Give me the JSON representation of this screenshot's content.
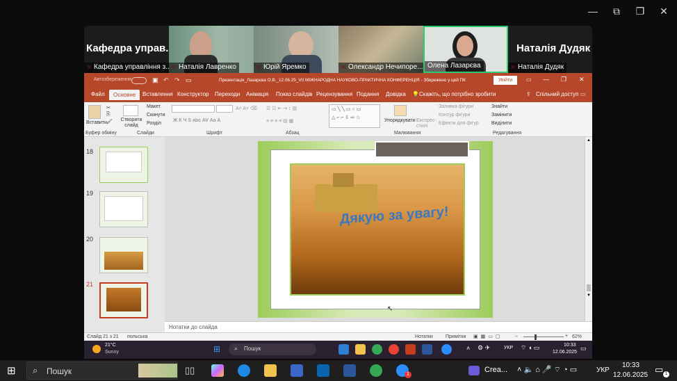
{
  "zoom": {
    "window_controls": [
      "—",
      "❐",
      "✕"
    ],
    "participants": [
      {
        "name": "Кафедра управ...",
        "label": "Кафедра управління з...",
        "muted": true
      },
      {
        "name": "Наталія Лавренко",
        "muted": true
      },
      {
        "name": "Юрій Яремко",
        "muted": true
      },
      {
        "name": "Олександр Нечипоре...",
        "muted": true
      },
      {
        "name": "Олена Лазарєва",
        "muted": false,
        "active": true
      },
      {
        "name": "Наталія Дудяк",
        "label": "Наталія Дудяк",
        "muted": true
      }
    ]
  },
  "powerpoint": {
    "autosave_label": "Автозбереження",
    "title": "Презентація_Лазарєва О.В._12.06.25_VII МІЖНАРОДНА НАУКОВО-ПРАКТИЧНА КОНФЕРЕНЦІЯ  -  Збережено у цей ПК",
    "signin": "Увійти",
    "tabs": [
      "Файл",
      "Основне",
      "Вставлення",
      "Конструктор",
      "Переходи",
      "Анімація",
      "Показ слайдів",
      "Рецензування",
      "Подання",
      "Довідка"
    ],
    "active_tab": "Основне",
    "tell_me": "Скажіть, що потрібно зробити",
    "share": "Спільний доступ",
    "ribbon": {
      "paste": "Вставити",
      "new_slide": "Створити слайд",
      "layout": "Макет",
      "reset": "Скинути",
      "section": "Розділ",
      "arrange": "Упорядкувати",
      "quick_styles": "Експрес-стилі",
      "shape_fill": "Заливка фігури",
      "shape_outline": "Контур фігури",
      "shape_effects": "Ефекти для фігур",
      "find": "Знайти",
      "replace": "Замінити",
      "select": "Виділити",
      "groups": [
        "Буфер обміну",
        "Слайди",
        "Шрифт",
        "Абзац",
        "Малювання",
        "Редагування"
      ]
    },
    "thumbnails": [
      {
        "num": "18"
      },
      {
        "num": "19"
      },
      {
        "num": "20"
      },
      {
        "num": "21",
        "selected": true
      }
    ],
    "slide_text": "Дякую за увагу!",
    "notes_placeholder": "Нотатки до слайда",
    "status": {
      "slide": "Слайд 21 з 21",
      "language": "польська",
      "notes": "Нотатки",
      "comments": "Примітки",
      "zoom": "62%"
    }
  },
  "inner_taskbar": {
    "weather_temp": "21°C",
    "weather_desc": "Sunny",
    "search": "Пошук",
    "lang": "УКР",
    "time": "10:33",
    "date": "12.06.2025"
  },
  "taskbar": {
    "search": "Пошук",
    "app_label": "Crea...",
    "lang": "УКР",
    "time": "10:33",
    "date": "12.06.2025",
    "notif_count": "1"
  },
  "colors": {
    "ppt_accent": "#b7472a",
    "active_border": "#2ecc71",
    "slide_green": "#9ccc5a",
    "slide_text": "#3a78c0"
  }
}
